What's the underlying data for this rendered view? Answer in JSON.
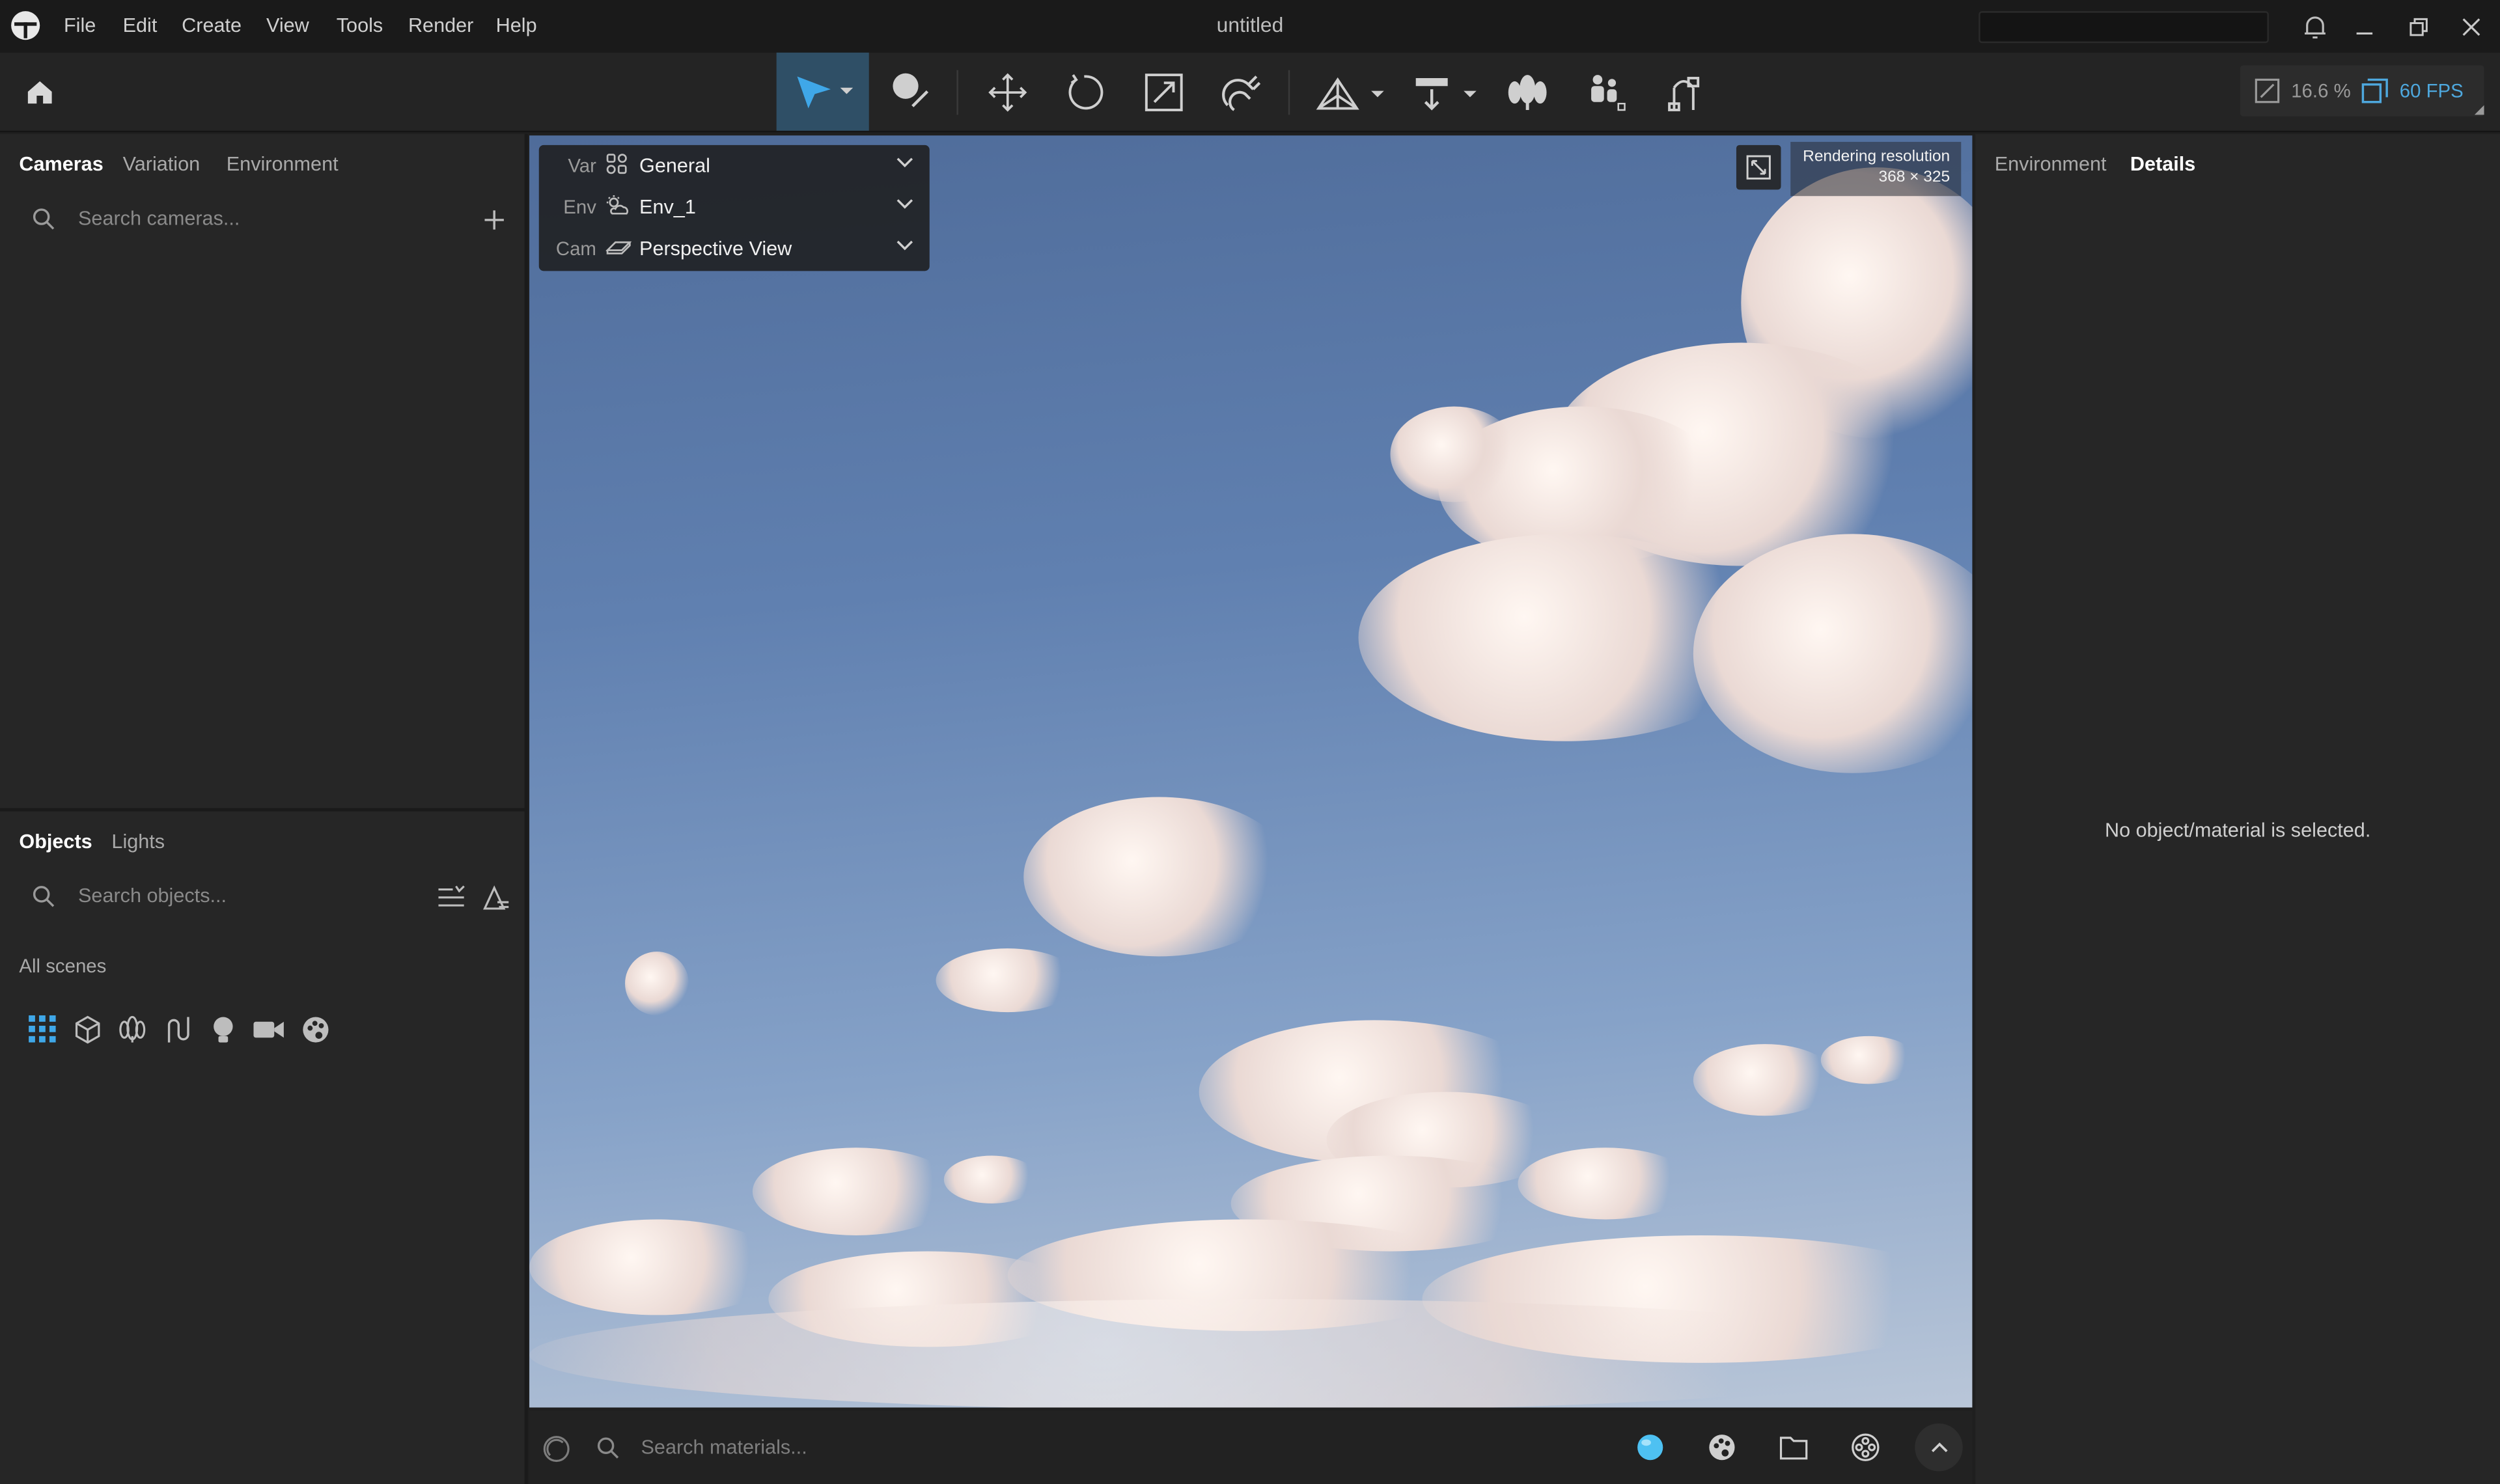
{
  "app": {
    "title": "untitled"
  },
  "menu": [
    "File",
    "Edit",
    "Create",
    "View",
    "Tools",
    "Render",
    "Help"
  ],
  "toolbar": {
    "tools": [
      {
        "icon": "select-arrow-icon",
        "selected": true
      },
      {
        "icon": "material-picker-icon"
      },
      {
        "icon": "move-icon"
      },
      {
        "icon": "rotate-icon"
      },
      {
        "icon": "scale-icon"
      },
      {
        "icon": "magnet-snap-icon"
      },
      {
        "icon": "terrain-tool-icon"
      },
      {
        "icon": "place-object-icon"
      },
      {
        "icon": "tree-tool-icon"
      },
      {
        "icon": "people-tool-icon"
      },
      {
        "icon": "path-tool-icon"
      }
    ],
    "zoom": "16.6 %",
    "fps": "60 FPS"
  },
  "left_top": {
    "tabs": [
      "Cameras",
      "Variation",
      "Environment"
    ],
    "active_tab": "Cameras",
    "search_placeholder": "Search cameras..."
  },
  "left_bottom": {
    "tabs": [
      "Objects",
      "Lights"
    ],
    "active_tab": "Objects",
    "search_placeholder": "Search objects...",
    "scope_label": "All scenes",
    "filters": [
      "grid-all-icon",
      "cube-icon",
      "tree-icon",
      "path-icon",
      "light-bulb-icon",
      "video-camera-icon",
      "palette-icon"
    ]
  },
  "viewport": {
    "overlay": [
      {
        "key": "Var",
        "value": "General",
        "icon": "variation-grid-icon"
      },
      {
        "key": "Env",
        "value": "Env_1",
        "icon": "weather-icon"
      },
      {
        "key": "Cam",
        "value": "Perspective View",
        "icon": "perspective-icon"
      }
    ],
    "resolution_label": "Rendering resolution",
    "resolution_value": "368 × 325"
  },
  "materials": {
    "search_placeholder": "Search materials..."
  },
  "right": {
    "tabs": [
      "Environment",
      "Details"
    ],
    "active_tab": "Details",
    "empty_message": "No object/material is selected."
  },
  "colors": {
    "accent": "#4ea8de",
    "selected_tool_bg": "#2f4f66",
    "panel_bg": "#262626"
  }
}
